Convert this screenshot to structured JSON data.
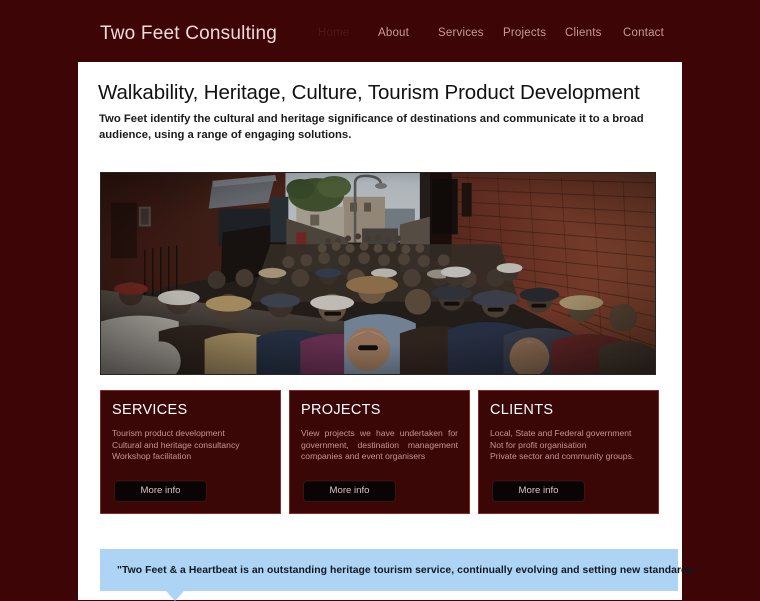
{
  "header": {
    "brand": "Two Feet Consulting",
    "nav": [
      {
        "label": "Home",
        "active": true
      },
      {
        "label": "About",
        "active": false
      },
      {
        "label": "Services",
        "active": false
      },
      {
        "label": "Projects",
        "active": false
      },
      {
        "label": "Clients",
        "active": false
      },
      {
        "label": "Contact",
        "active": false
      }
    ]
  },
  "main": {
    "heading": "Walkability, Heritage, Culture, Tourism Product Development",
    "intro": "Two Feet identify the cultural and heritage significance of destinations and communicate it to a broad audience, using a range of engaging solutions.",
    "hero_photo_alt": "Large crowd of people on a walking tour in a narrow brick laneway"
  },
  "cards": [
    {
      "title": "SERVICES",
      "body": "Tourism product development\nCultural and heritage consultancy\nWorkshop facilitation",
      "button": "More info",
      "justify": false
    },
    {
      "title": "PROJECTS",
      "body": "View projects we have undertaken for government, destination management companies and event organisers",
      "button": "More info",
      "justify": true
    },
    {
      "title": "CLIENTS",
      "body": "Local, State and Federal government\nNot for profit organisation\nPrivate sector and community groups.",
      "button": "More info",
      "justify": false
    }
  ],
  "testimonial": {
    "quote": "\"Two Feet & a Heartbeat is an outstanding heritage tourism service, continually evolving and setting new standards.\""
  },
  "colors": {
    "page_background": "#3d0505",
    "panel_background": "#ffffff",
    "brand_text": "#f0d9d9",
    "nav_text": "#c99a9a",
    "nav_active": "#521616",
    "card_background": "#3a0606",
    "card_border": "#8a2b2b",
    "card_body_text": "#c79595",
    "button_background": "#0a0404",
    "testimonial_background": "#aed4f5"
  }
}
